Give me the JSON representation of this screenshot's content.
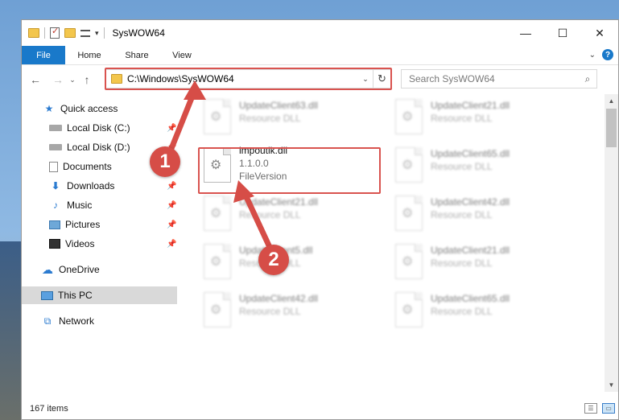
{
  "window": {
    "title": "SysWOW64",
    "controls": {
      "minimize": "—",
      "maximize": "☐",
      "close": "✕"
    }
  },
  "ribbon": {
    "tabs": [
      "File",
      "Home",
      "Share",
      "View"
    ],
    "expand_chevron": "⌄",
    "help": "?"
  },
  "nav": {
    "back": "←",
    "forward": "→",
    "recent": "⌄",
    "up": "↑",
    "address": "C:\\Windows\\SysWOW64",
    "address_dropdown": "⌄",
    "refresh": "↻",
    "search_placeholder": "Search SysWOW64",
    "search_icon": "⌕"
  },
  "sidebar": {
    "items": [
      {
        "label": "Quick access",
        "icon": "star-icon",
        "glyph": "★"
      },
      {
        "label": "Local Disk (C:)",
        "icon": "disk-icon",
        "pinned": true
      },
      {
        "label": "Local Disk (D:)",
        "icon": "disk-icon",
        "pinned": true
      },
      {
        "label": "Documents",
        "icon": "documents-icon",
        "pinned": true
      },
      {
        "label": "Downloads",
        "icon": "download-icon",
        "glyph": "⬇",
        "pinned": true
      },
      {
        "label": "Music",
        "icon": "music-icon",
        "glyph": "♪",
        "pinned": true
      },
      {
        "label": "Pictures",
        "icon": "pictures-icon",
        "pinned": true
      },
      {
        "label": "Videos",
        "icon": "videos-icon",
        "pinned": true
      },
      {
        "label": "OneDrive",
        "icon": "cloud-icon",
        "glyph": "☁"
      },
      {
        "label": "This PC",
        "icon": "computer-icon",
        "selected": true
      },
      {
        "label": "Network",
        "icon": "network-icon",
        "glyph": "⧉"
      }
    ],
    "pin_glyph": "📌"
  },
  "files": {
    "gear_glyph": "⚙",
    "tiles": [
      {
        "name": "UpdateClient63.dll",
        "sub": "Resource DLL"
      },
      {
        "name": "UpdateClient21.dll",
        "sub": "Resource DLL"
      },
      {
        "name": "impoutlk.dll",
        "version": "1.1.0.0",
        "sub": "FileVersion"
      },
      {
        "name": "UpdateClient65.dll",
        "sub": "Resource DLL"
      },
      {
        "name": "UpdateClient21.dll",
        "sub": "Resource DLL"
      },
      {
        "name": "UpdateClient42.dll",
        "sub": "Resource DLL"
      },
      {
        "name": "UpdateClient5.dll",
        "sub": "Resource DLL"
      },
      {
        "name": "UpdateClient21.dll",
        "sub": "Resource DLL"
      },
      {
        "name": "UpdateClient42.dll",
        "sub": "Resource DLL"
      },
      {
        "name": "UpdateClient65.dll",
        "sub": "Resource DLL"
      }
    ]
  },
  "status": {
    "items_count": "167 items"
  },
  "annotations": {
    "step1": "1",
    "step2": "2"
  },
  "colors": {
    "accent": "#1979ca",
    "highlight": "#d9534f"
  }
}
